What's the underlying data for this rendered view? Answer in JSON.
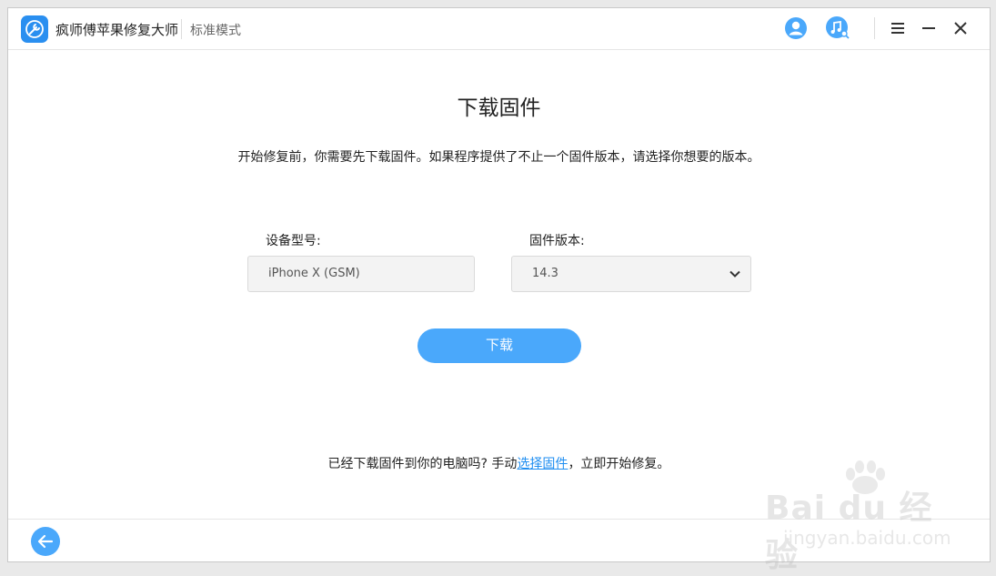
{
  "app": {
    "title": "疯师傅苹果修复大师",
    "mode": "标准模式"
  },
  "titlebar_icons": [
    "user-icon",
    "music-search-icon",
    "menu-icon",
    "minimize-icon",
    "close-icon"
  ],
  "main": {
    "heading": "下载固件",
    "description": "开始修复前，你需要先下载固件。如果程序提供了不止一个固件版本，请选择你想要的版本。",
    "device_label": "设备型号:",
    "device_value": "iPhone X (GSM)",
    "firmware_label": "固件版本:",
    "firmware_value": "14.3",
    "download_button": "下载"
  },
  "footer": {
    "note_prefix": "已经下载固件到你的电脑吗? 手动",
    "note_link": "选择固件",
    "note_suffix": "，立即开始修复。"
  },
  "watermark": {
    "text": "Bai du 经验",
    "sub": "jingyan.baidu.com"
  },
  "colors": {
    "accent": "#4aa8fb",
    "link": "#1f8ef1",
    "logo": "#2a8ff0"
  }
}
